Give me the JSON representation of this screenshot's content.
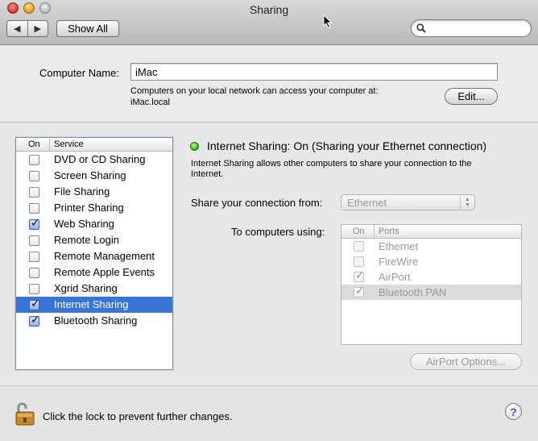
{
  "window": {
    "title": "Sharing"
  },
  "toolbar": {
    "back_glyph": "◀",
    "forward_glyph": "▶",
    "show_all_label": "Show All",
    "search": {
      "value": "",
      "placeholder": ""
    }
  },
  "computer_name": {
    "label": "Computer Name:",
    "value": "iMac",
    "description_line1": "Computers on your local network can access your computer at:",
    "description_line2": "iMac.local",
    "edit_label": "Edit..."
  },
  "services": {
    "header_on": "On",
    "header_service": "Service",
    "items": [
      {
        "label": "DVD or CD Sharing",
        "checked": false,
        "selected": false
      },
      {
        "label": "Screen Sharing",
        "checked": false,
        "selected": false
      },
      {
        "label": "File Sharing",
        "checked": false,
        "selected": false
      },
      {
        "label": "Printer Sharing",
        "checked": false,
        "selected": false
      },
      {
        "label": "Web Sharing",
        "checked": true,
        "selected": false
      },
      {
        "label": "Remote Login",
        "checked": false,
        "selected": false
      },
      {
        "label": "Remote Management",
        "checked": false,
        "selected": false
      },
      {
        "label": "Remote Apple Events",
        "checked": false,
        "selected": false
      },
      {
        "label": "Xgrid Sharing",
        "checked": false,
        "selected": false
      },
      {
        "label": "Internet Sharing",
        "checked": true,
        "selected": true
      },
      {
        "label": "Bluetooth Sharing",
        "checked": true,
        "selected": false
      }
    ]
  },
  "detail": {
    "status_color": "#3ab81e",
    "status_text": "Internet Sharing: On (Sharing your Ethernet connection)",
    "description_line1": "Internet Sharing allows other computers to share your connection to the",
    "description_line2": "Internet.",
    "share_from_label": "Share your connection from:",
    "share_from_value": "Ethernet",
    "to_computers_label": "To computers using:",
    "ports_header_on": "On",
    "ports_header_ports": "Ports",
    "ports": [
      {
        "label": "Ethernet",
        "checked": false,
        "highlighted": false
      },
      {
        "label": "FireWire",
        "checked": false,
        "highlighted": false
      },
      {
        "label": "AirPort",
        "checked": true,
        "highlighted": false
      },
      {
        "label": "Bluetooth PAN",
        "checked": true,
        "highlighted": true
      }
    ],
    "airport_options_label": "AirPort Options..."
  },
  "footer": {
    "lock_text": "Click the lock to prevent further changes.",
    "help_glyph": "?"
  },
  "colors": {
    "selection": "#3875d7",
    "accent": "#3875d7"
  }
}
